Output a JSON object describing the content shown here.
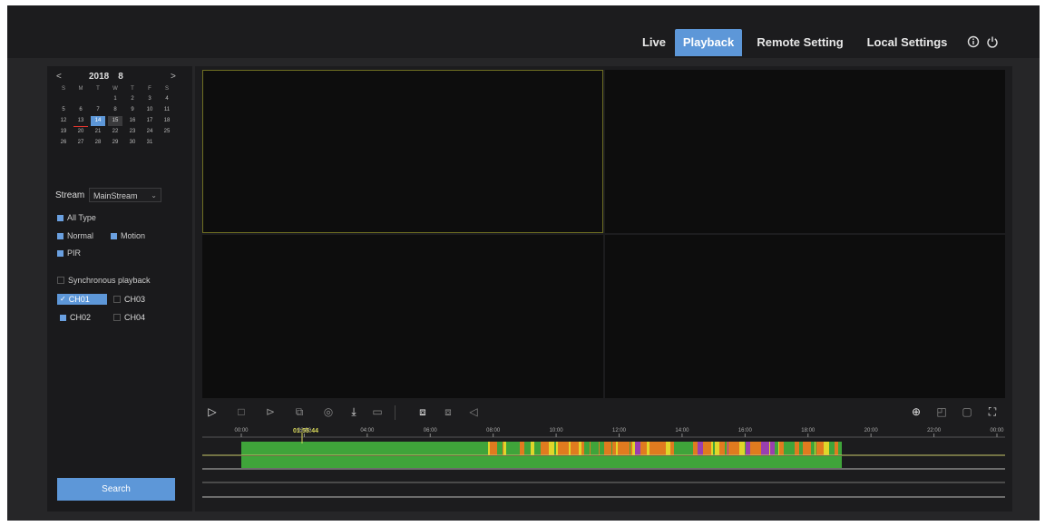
{
  "nav": {
    "live": "Live",
    "playback": "Playback",
    "remote": "Remote Setting",
    "local": "Local Settings",
    "icons": [
      "info-icon",
      "power-icon"
    ]
  },
  "calendar": {
    "year": "2018",
    "month": "8",
    "prev": "<",
    "next": ">",
    "weekdays": [
      "S",
      "M",
      "T",
      "W",
      "T",
      "F",
      "S"
    ],
    "days": [
      "1",
      "2",
      "3",
      "4",
      "5",
      "6",
      "7",
      "8",
      "9",
      "10",
      "11",
      "12",
      "13",
      "14",
      "15",
      "16",
      "17",
      "18",
      "19",
      "20",
      "21",
      "22",
      "23",
      "24",
      "25",
      "26",
      "27",
      "28",
      "29",
      "30",
      "31"
    ],
    "selected_day": "14",
    "record_days": [
      "15"
    ],
    "today_day": "13"
  },
  "stream": {
    "label": "Stream",
    "value": "MainStream"
  },
  "filters": {
    "all": "All Type",
    "normal": "Normal",
    "motion": "Motion",
    "pir": "PIR"
  },
  "sync": {
    "label": "Synchronous playback"
  },
  "channels": [
    {
      "label": "CH01",
      "checked": true
    },
    {
      "label": "CH03",
      "checked": false
    },
    {
      "label": "CH02",
      "checked": true
    },
    {
      "label": "CH04",
      "checked": false
    }
  ],
  "search_label": "Search",
  "timeline": {
    "cursor": "01:55:44",
    "ticks": [
      "00:00",
      "02:00",
      "04:00",
      "06:00",
      "08:00",
      "10:00",
      "12:00",
      "14:00",
      "16:00",
      "18:00",
      "20:00",
      "22:00",
      "00:00"
    ],
    "colors": {
      "normal": "#3fa43a",
      "motion": "#e07b1f",
      "pir": "#e0d62a",
      "alarm": "#9a3fb0"
    }
  },
  "colors": {
    "accent": "#5d97d8",
    "panel": "#1a1a1c",
    "tile_border": "#6f6f22"
  }
}
